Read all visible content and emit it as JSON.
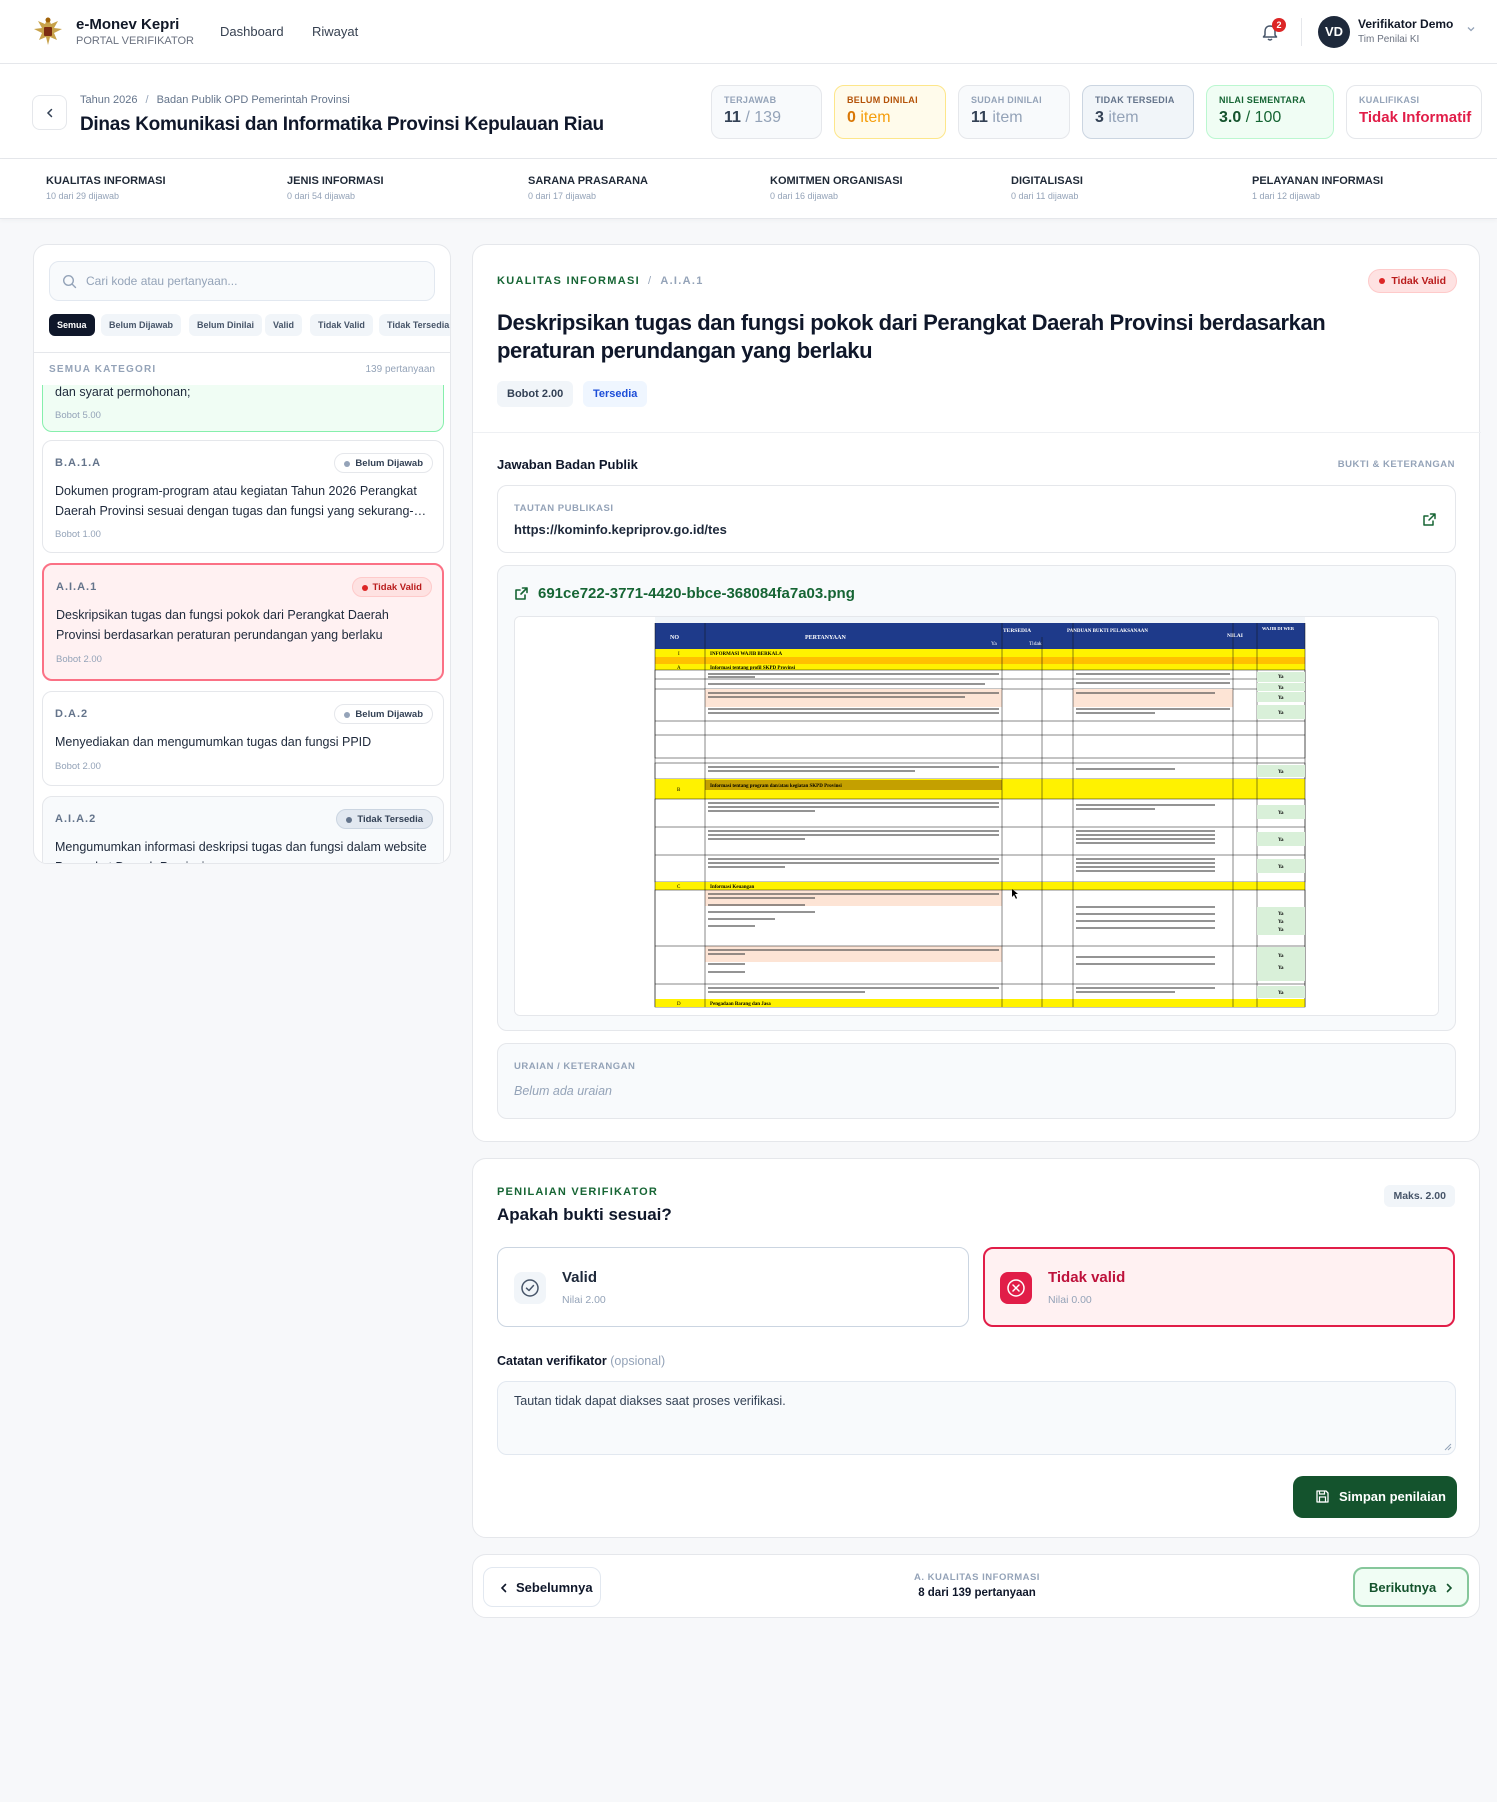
{
  "app": {
    "name": "e-Monev Kepri",
    "subtitle": "PORTAL VERIFIKATOR"
  },
  "nav": {
    "dashboard": "Dashboard",
    "riwayat": "Riwayat"
  },
  "notifications": {
    "count": "2"
  },
  "user": {
    "initials": "VD",
    "name": "Verifikator Demo",
    "role": "Tim Penilai KI"
  },
  "breadcrumb": {
    "year": "Tahun 2026",
    "group": "Badan Publik OPD Pemerintah Provinsi"
  },
  "page_title": "Dinas Komunikasi dan Informatika Provinsi Kepulauan Riau",
  "stats": {
    "terjawab": {
      "label": "TERJAWAB",
      "value": "11",
      "max": "/ 139"
    },
    "belum_dinilai": {
      "label": "BELUM DINILAI",
      "value": "0",
      "unit": "item"
    },
    "sudah_dinilai": {
      "label": "SUDAH DINILAI",
      "value": "11",
      "unit": "item"
    },
    "tidak_tersedia": {
      "label": "TIDAK TERSEDIA",
      "value": "3",
      "unit": "item"
    },
    "nilai": {
      "label": "NILAI SEMENTARA",
      "value": "3.0",
      "max": "/ 100"
    },
    "kualifikasi": {
      "label": "KUALIFIKASI",
      "value": "Tidak Informatif"
    }
  },
  "categories": [
    {
      "name": "KUALITAS INFORMASI",
      "progress": "10 dari 29 dijawab"
    },
    {
      "name": "JENIS INFORMASI",
      "progress": "0 dari 54 dijawab"
    },
    {
      "name": "SARANA PRASARANA",
      "progress": "0 dari 17 dijawab"
    },
    {
      "name": "KOMITMEN ORGANISASI",
      "progress": "0 dari 16 dijawab"
    },
    {
      "name": "DIGITALISASI",
      "progress": "0 dari 11 dijawab"
    },
    {
      "name": "PELAYANAN INFORMASI",
      "progress": "1 dari 12 dijawab"
    }
  ],
  "sidebar": {
    "search_placeholder": "Cari kode atau pertanyaan...",
    "filters": [
      "Semua",
      "Belum Dijawab",
      "Belum Dinilai",
      "Valid",
      "Tidak Valid",
      "Tidak Tersedia"
    ],
    "heading": "SEMUA KATEGORI",
    "count": "139 pertanyaan",
    "items": [
      {
        "code": "",
        "text": "dan syarat permohonan;",
        "bobot": "Bobot 5.00",
        "status": ""
      },
      {
        "code": "B.A.1.A",
        "text": "Dokumen program-program atau kegiatan Tahun 2026 Perangkat Daerah Provinsi sesuai dengan tugas dan fungsi yang sekurang-…",
        "bobot": "Bobot 1.00",
        "status": "Belum Dijawab"
      },
      {
        "code": "A.I.A.1",
        "text": "Deskripsikan tugas dan fungsi pokok dari Perangkat Daerah Provinsi berdasarkan peraturan perundangan yang berlaku",
        "bobot": "Bobot 2.00",
        "status": "Tidak Valid"
      },
      {
        "code": "D.A.2",
        "text": "Menyediakan dan mengumumkan tugas dan fungsi PPID",
        "bobot": "Bobot 2.00",
        "status": "Belum Dijawab"
      },
      {
        "code": "A.I.A.2",
        "text": "Mengumumkan informasi deskripsi tugas dan fungsi dalam website Perangkat Daerah Provinsi",
        "bobot": "",
        "status": "Tidak Tersedia"
      }
    ]
  },
  "question": {
    "category": "KUALITAS INFORMASI",
    "code": "A.I.A.1",
    "status": "Tidak Valid",
    "title": "Deskripsikan tugas dan fungsi pokok dari Perangkat Daerah Provinsi berdasarkan peraturan perundangan yang berlaku",
    "bobot": "Bobot 2.00",
    "availability": "Tersedia"
  },
  "answer": {
    "heading": "Jawaban Badan Publik",
    "aside": "BUKTI & KETERANGAN",
    "link_label": "TAUTAN PUBLIKASI",
    "link_url": "https://kominfo.kepriprov.go.id/tes",
    "file_name": "691ce722-3771-4420-bbce-368084fa7a03.png",
    "uraian_label": "URAIAN / KETERANGAN",
    "uraian_value": "Belum ada uraian"
  },
  "preview": {
    "headers": [
      "NO",
      "PERTANYAAN",
      "TERSEDIA",
      "Ya",
      "Tidak",
      "PANDUAN BUKTI PELAKSANAAN",
      "NILAI",
      "WAJIB DI WEB"
    ],
    "sections": [
      {
        "no": "I",
        "text": "INFORMASI WAJIB BERKALA"
      },
      {
        "no": "A",
        "text": "Informasi tentang profil SKPD Provinsi"
      },
      {
        "no": "B",
        "text": "Informasi tentang program dan/atau kegiatan SKPD Provinsi"
      },
      {
        "no": "C",
        "text": "Informasi Keuangan"
      },
      {
        "no": "D",
        "text": "Pengadaan Barang dan Jasa"
      }
    ],
    "cell_value": "Ya"
  },
  "verification": {
    "label": "PENILAIAN VERIFIKATOR",
    "question": "Apakah bukti sesuai?",
    "max": "Maks. 2.00",
    "valid": {
      "title": "Valid",
      "score": "Nilai 2.00"
    },
    "invalid": {
      "title": "Tidak valid",
      "score": "Nilai 0.00"
    },
    "notes_label": "Catatan verifikator",
    "notes_optional": "(opsional)",
    "notes_value": "Tautan tidak dapat diakses saat proses verifikasi.",
    "save": "Simpan penilaian"
  },
  "pager": {
    "prev": "Sebelumnya",
    "next": "Berikutnya",
    "section": "A. KUALITAS INFORMASI",
    "position": "8 dari 139 pertanyaan"
  },
  "colors": {
    "accent": "#166534",
    "danger": "#dc2626",
    "warning": "#d97706",
    "dark": "#0f172a"
  }
}
